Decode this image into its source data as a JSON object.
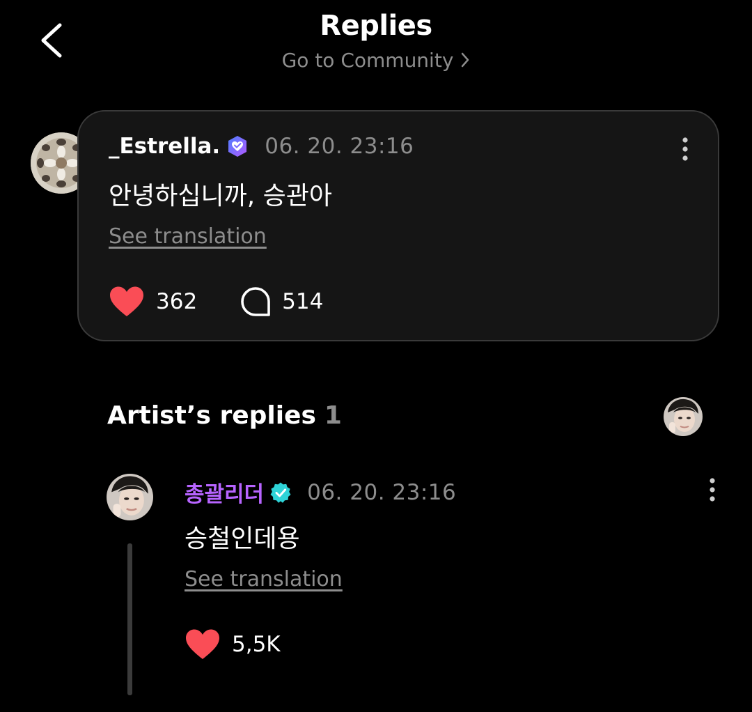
{
  "header": {
    "title": "Replies",
    "community_link": "Go to Community"
  },
  "post": {
    "author": "_Estrella.",
    "timestamp": "06. 20. 23:16",
    "body": "안녕하십니까, 승관아",
    "translate_label": "See translation",
    "likes": "362",
    "comments": "514"
  },
  "artist_replies": {
    "title": "Artist’s replies",
    "count": "1",
    "reply": {
      "author": "총괄리더",
      "timestamp": "06. 20. 23:16",
      "body": "승철인데용",
      "translate_label": "See translation",
      "likes": "5,5K"
    }
  },
  "icons": {
    "back": "chevron-left-icon",
    "community_chevron": "chevron-right-icon",
    "fan_badge": "heart-shield-badge-icon",
    "artist_badge": "verified-check-badge-icon",
    "more": "vertical-ellipsis-icon",
    "like": "heart-icon",
    "comment": "speech-bubble-icon"
  },
  "colors": {
    "background": "#000000",
    "card": "#151515",
    "muted_text": "#8d8d8d",
    "artist_name": "#b764ff",
    "heart": "#fa4d56",
    "artist_badge": "#2ed3d7",
    "fan_badge_gradient": [
      "#4f7dff",
      "#b05bff"
    ]
  }
}
